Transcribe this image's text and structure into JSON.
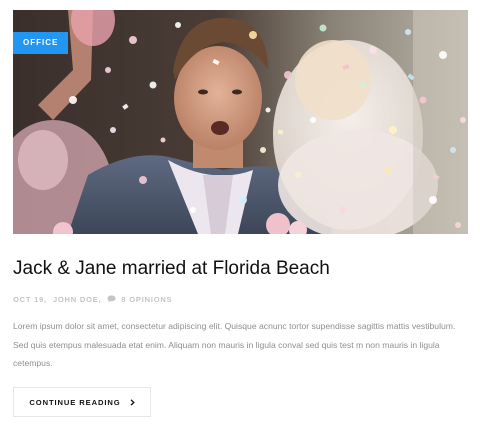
{
  "post": {
    "category": "OFFICE",
    "title": "Jack & Jane married at Florida Beach",
    "meta": {
      "date": "OCT 19,",
      "author": "JOHN DOE,",
      "comment_icon": "comment-bubble-icon",
      "comments": "8 OPINIONS"
    },
    "excerpt": "Lorem ipsum dolor sit amet, consectetur adipiscing elit. Quisque acnunc tortor supendisse sagittis mattis vestibulum. Sed quis etempus malesuada etat enim. Aliquam non mauris in ligula conval sed quis test m non mauris in ligula cetempus.",
    "read_more": {
      "label": "CONTINUE READING",
      "icon": "chevron-right-icon"
    }
  },
  "colors": {
    "accent": "#2196f3",
    "title": "#111111",
    "meta": "#c4c4c4",
    "excerpt": "#8f8f8f",
    "button_border": "#e7e7e7"
  }
}
